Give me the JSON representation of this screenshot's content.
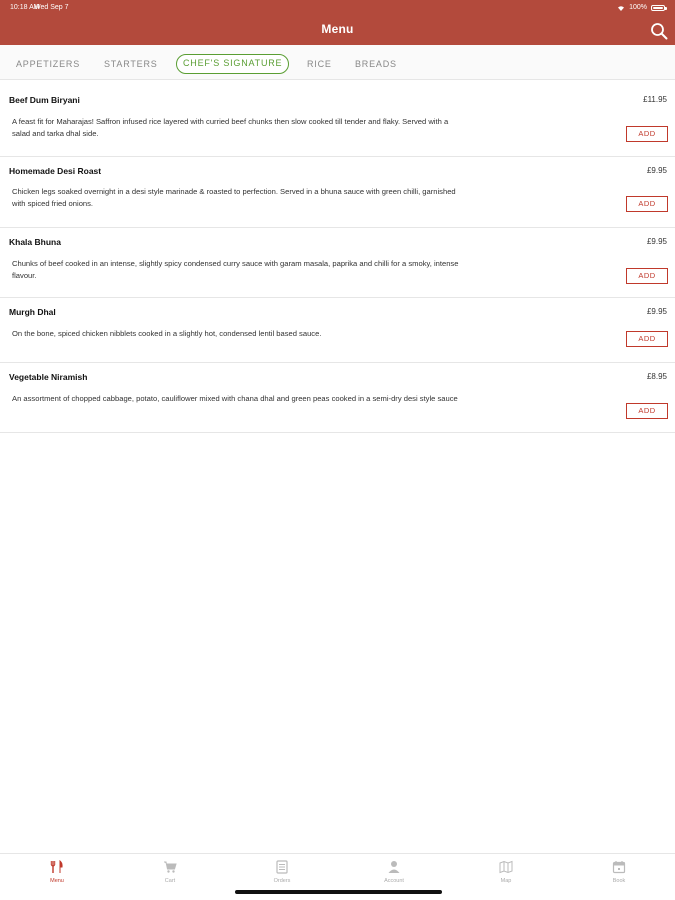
{
  "status_bar": {
    "time": "10:18 AM",
    "date": "Wed Sep 7",
    "battery": "100%"
  },
  "header": {
    "title": "Menu"
  },
  "tabs": [
    {
      "label": "APPETIZERS",
      "active": false
    },
    {
      "label": "STARTERS",
      "active": false
    },
    {
      "label": "CHEF'S SIGNATURE",
      "active": true
    },
    {
      "label": "RICE",
      "active": false
    },
    {
      "label": "BREADS",
      "active": false
    }
  ],
  "menu_items": [
    {
      "name": "Beef Dum Biryani",
      "price": "£11.95",
      "description": "A feast fit for Maharajas! Saffron infused rice layered with curried beef chunks then slow cooked till tender and flaky. Served with a salad and tarka dhal side.",
      "add_label": "ADD"
    },
    {
      "name": "Homemade Desi Roast",
      "price": "£9.95",
      "description": "Chicken legs soaked overnight in a desi style marinade & roasted to perfection. Served in a bhuna sauce with green chilli, garnished with spiced fried onions.",
      "add_label": "ADD"
    },
    {
      "name": "Khala Bhuna",
      "price": "£9.95",
      "description": "Chunks of beef cooked in an intense, slightly spicy condensed curry sauce with garam masala, paprika and chilli for a smoky, intense flavour.",
      "add_label": "ADD"
    },
    {
      "name": "Murgh Dhal",
      "price": "£9.95",
      "description": "On the bone, spiced chicken nibblets cooked in a slightly hot, condensed lentil based sauce.",
      "add_label": "ADD"
    },
    {
      "name": "Vegetable Niramish",
      "price": "£8.95",
      "description": "An assortment of chopped cabbage, potato, cauliflower mixed with chana dhal and green peas cooked in a semi-dry desi style sauce",
      "add_label": "ADD"
    }
  ],
  "bottom_nav": [
    {
      "label": "Menu",
      "icon": "cutlery-icon",
      "active": true
    },
    {
      "label": "Cart",
      "icon": "cart-icon",
      "active": false
    },
    {
      "label": "Orders",
      "icon": "orders-icon",
      "active": false
    },
    {
      "label": "Account",
      "icon": "account-icon",
      "active": false
    },
    {
      "label": "Map",
      "icon": "map-icon",
      "active": false
    },
    {
      "label": "Book",
      "icon": "calendar-icon",
      "active": false
    }
  ],
  "colors": {
    "header": "#b34a3c",
    "accent_red": "#c0392b",
    "active_tab_green": "#5a9e33"
  }
}
